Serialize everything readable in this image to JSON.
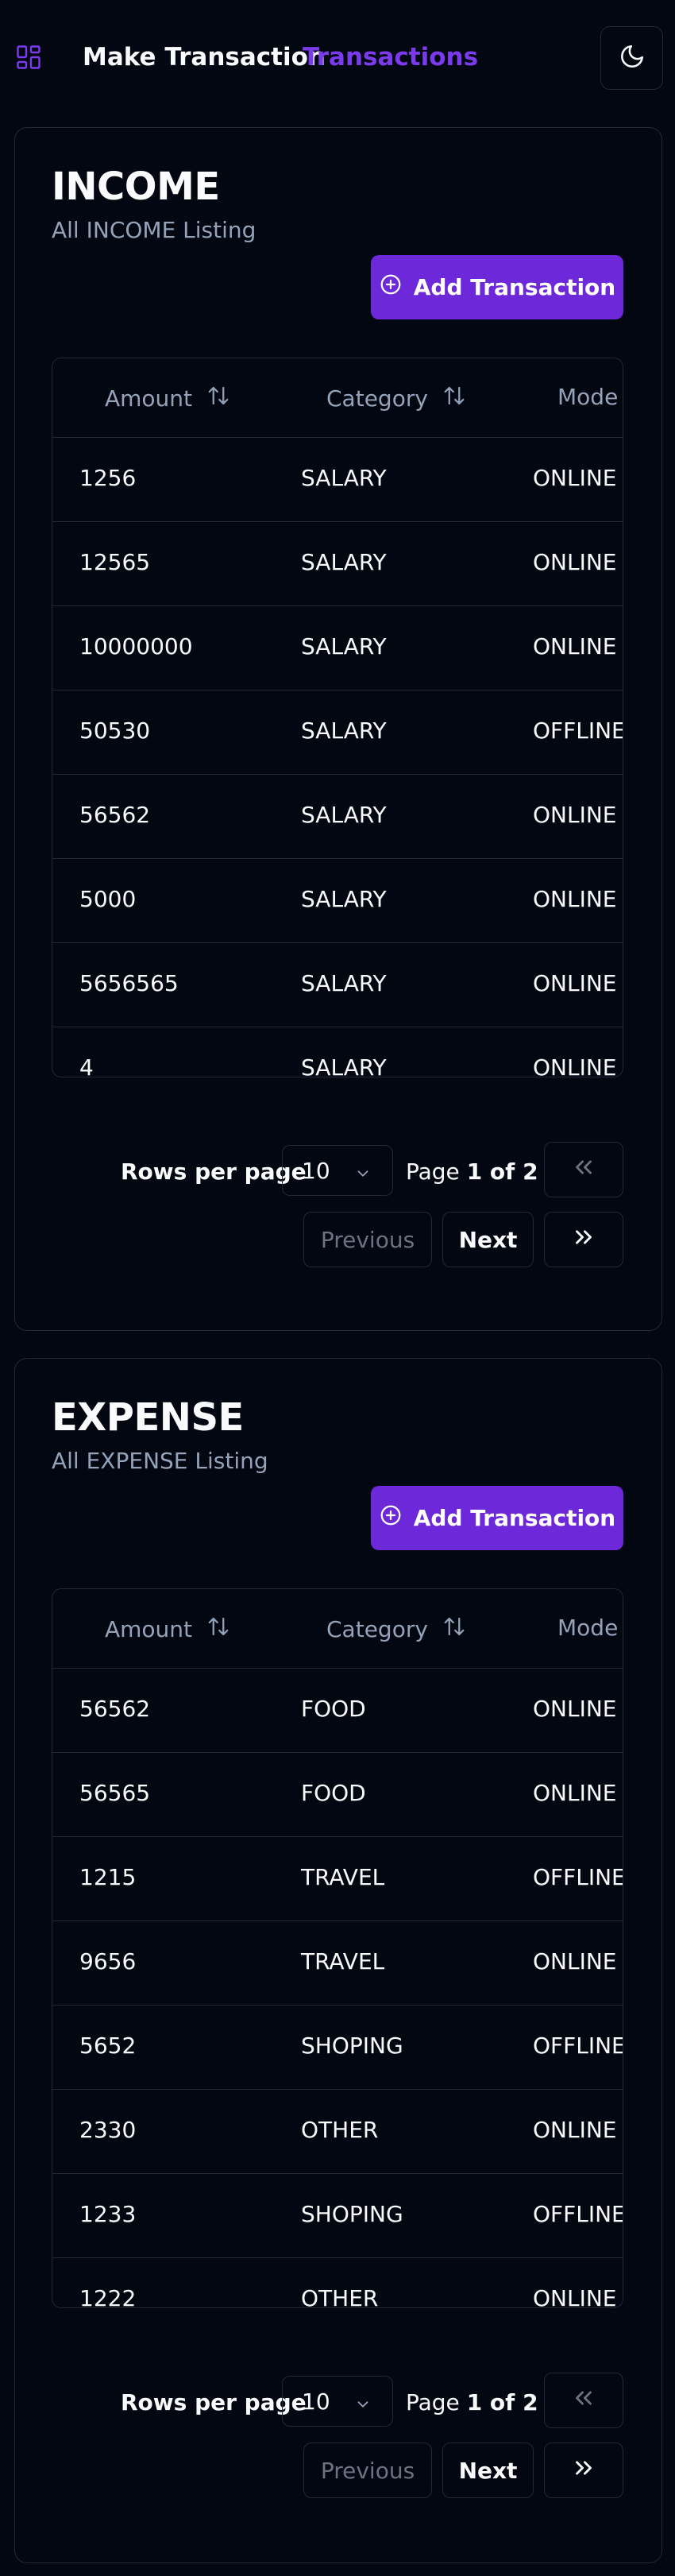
{
  "header": {
    "logo_icon": "layout-grid-icon",
    "make_transaction": "Make Transaction",
    "transactions": "Transactions",
    "theme_icon": "moon-icon"
  },
  "colors": {
    "accent": "#7c3aed",
    "button": "#6d28d9",
    "background": "#030712",
    "border": "#1f2937",
    "muted": "#94a3b8"
  },
  "income": {
    "title": "INCOME",
    "subtitle": "All INCOME Listing",
    "add_label": "Add Transaction",
    "columns": {
      "amount": "Amount",
      "category": "Category",
      "mode": "Mode"
    },
    "rows": [
      {
        "amount": "1256",
        "category": "SALARY",
        "mode": "ONLINE"
      },
      {
        "amount": "12565",
        "category": "SALARY",
        "mode": "ONLINE"
      },
      {
        "amount": "10000000",
        "category": "SALARY",
        "mode": "ONLINE"
      },
      {
        "amount": "50530",
        "category": "SALARY",
        "mode": "OFFLINE"
      },
      {
        "amount": "56562",
        "category": "SALARY",
        "mode": "ONLINE"
      },
      {
        "amount": "5000",
        "category": "SALARY",
        "mode": "ONLINE"
      },
      {
        "amount": "5656565",
        "category": "SALARY",
        "mode": "ONLINE"
      },
      {
        "amount": "4",
        "category": "SALARY",
        "mode": "ONLINE"
      }
    ],
    "pagination": {
      "rows_label": "Rows per page",
      "rows_value": "10",
      "page_prefix": "Page",
      "page_of": "1 of 2",
      "previous": "Previous",
      "next": "Next"
    }
  },
  "expense": {
    "title": "EXPENSE",
    "subtitle": "All EXPENSE Listing",
    "add_label": "Add Transaction",
    "columns": {
      "amount": "Amount",
      "category": "Category",
      "mode": "Mode"
    },
    "rows": [
      {
        "amount": "56562",
        "category": "FOOD",
        "mode": "ONLINE"
      },
      {
        "amount": "56565",
        "category": "FOOD",
        "mode": "ONLINE"
      },
      {
        "amount": "1215",
        "category": "TRAVEL",
        "mode": "OFFLINE"
      },
      {
        "amount": "9656",
        "category": "TRAVEL",
        "mode": "ONLINE"
      },
      {
        "amount": "5652",
        "category": "SHOPING",
        "mode": "OFFLINE"
      },
      {
        "amount": "2330",
        "category": "OTHER",
        "mode": "ONLINE"
      },
      {
        "amount": "1233",
        "category": "SHOPING",
        "mode": "OFFLINE"
      },
      {
        "amount": "1222",
        "category": "OTHER",
        "mode": "ONLINE"
      }
    ],
    "pagination": {
      "rows_label": "Rows per page",
      "rows_value": "10",
      "page_prefix": "Page",
      "page_of": "1 of 2",
      "previous": "Previous",
      "next": "Next"
    }
  }
}
